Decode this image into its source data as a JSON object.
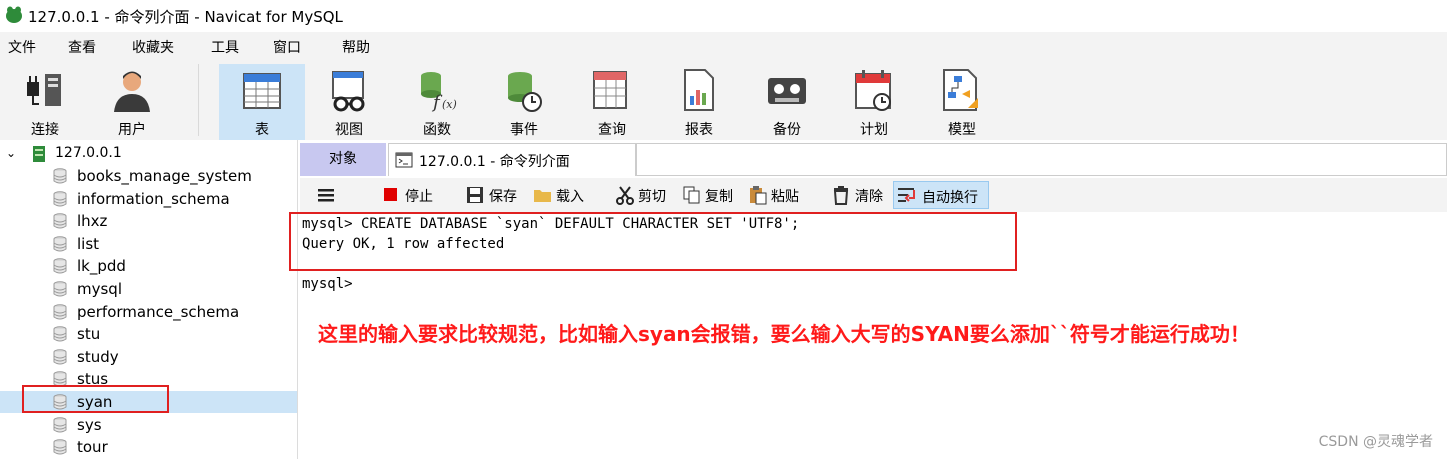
{
  "window": {
    "title": "127.0.0.1 - 命令列介面 - Navicat for MySQL"
  },
  "menu": [
    "文件",
    "查看",
    "收藏夹",
    "工具",
    "窗口",
    "帮助"
  ],
  "toolbar": {
    "connect": "连接",
    "user": "用户",
    "table": "表",
    "view": "视图",
    "function": "函数",
    "event": "事件",
    "query": "查询",
    "report": "报表",
    "backup": "备份",
    "schedule": "计划",
    "model": "模型"
  },
  "sidebar": {
    "server": "127.0.0.1",
    "databases": [
      "books_manage_system",
      "information_schema",
      "lhxz",
      "list",
      "lk_pdd",
      "mysql",
      "performance_schema",
      "stu",
      "study",
      "stus",
      "syan",
      "sys",
      "tour"
    ],
    "selected": "syan"
  },
  "tabs": {
    "objects": "对象",
    "console": "127.0.0.1 - 命令列介面"
  },
  "editor_toolbar": {
    "stop": "停止",
    "save": "保存",
    "load": "载入",
    "cut": "剪切",
    "copy": "复制",
    "paste": "粘贴",
    "clear": "清除",
    "wrap": "自动换行"
  },
  "console": {
    "line1": "mysql> CREATE DATABASE `syan` DEFAULT CHARACTER SET 'UTF8';",
    "line2": "Query OK, 1 row affected",
    "line3": "mysql>"
  },
  "annotation": "这里的输入要求比较规范，比如输入syan会报错，要么输入大写的SYAN要么添加``符号才能运行成功！",
  "watermark": "CSDN @灵魂学者",
  "colors": {
    "accent_selected": "#cce4f7",
    "annotation_red": "#ff1a1a",
    "objects_tab": "#c8c8f0"
  }
}
